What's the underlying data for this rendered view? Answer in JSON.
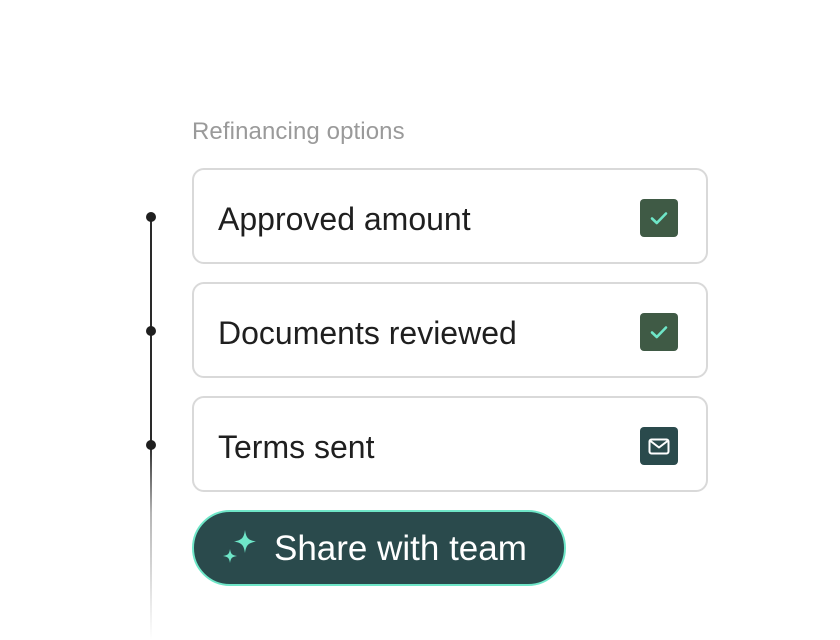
{
  "section": {
    "title": "Refinancing options"
  },
  "items": [
    {
      "label": "Approved amount",
      "status_icon": "check-icon",
      "status_color": "#3f5a45"
    },
    {
      "label": "Documents reviewed",
      "status_icon": "check-icon",
      "status_color": "#3f5a45"
    },
    {
      "label": "Terms sent",
      "status_icon": "mail-icon",
      "status_color": "#2a4a4c"
    }
  ],
  "share_button": {
    "label": "Share with team",
    "icon": "sparkle-icon",
    "background": "#2a4a4c",
    "border": "#6fe6c8",
    "icon_color": "#6fe6c8"
  },
  "colors": {
    "check_mark": "#6fe6c8",
    "text": "#1f1f1f",
    "muted_text": "#9a9a9a"
  }
}
